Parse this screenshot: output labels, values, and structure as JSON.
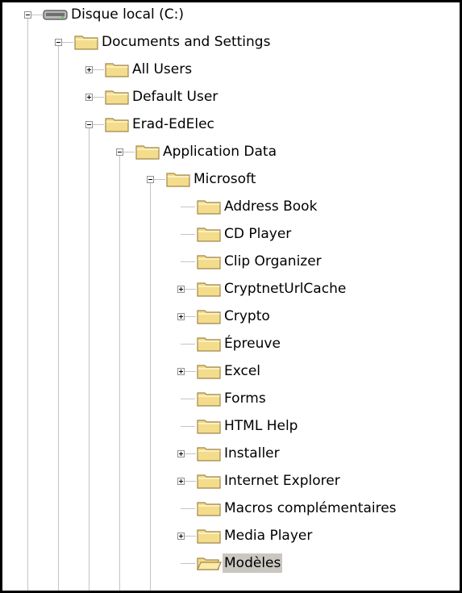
{
  "tree": {
    "nodes": [
      {
        "label": "Disque local (C:)",
        "level": 0,
        "expander": "minus",
        "icon": "drive-icon"
      },
      {
        "label": "Documents and Settings",
        "level": 1,
        "expander": "minus",
        "icon": "folder-icon"
      },
      {
        "label": "All Users",
        "level": 2,
        "expander": "plus",
        "icon": "folder-icon"
      },
      {
        "label": "Default User",
        "level": 2,
        "expander": "plus",
        "icon": "folder-icon"
      },
      {
        "label": "Erad-EdElec",
        "level": 2,
        "expander": "minus",
        "icon": "folder-icon"
      },
      {
        "label": "Application Data",
        "level": 3,
        "expander": "minus",
        "icon": "folder-icon"
      },
      {
        "label": "Microsoft",
        "level": 4,
        "expander": "minus",
        "icon": "folder-icon"
      },
      {
        "label": "Address Book",
        "level": 5,
        "expander": "none",
        "icon": "folder-icon"
      },
      {
        "label": "CD Player",
        "level": 5,
        "expander": "none",
        "icon": "folder-icon"
      },
      {
        "label": "Clip Organizer",
        "level": 5,
        "expander": "none",
        "icon": "folder-icon"
      },
      {
        "label": "CryptnetUrlCache",
        "level": 5,
        "expander": "plus",
        "icon": "folder-icon"
      },
      {
        "label": "Crypto",
        "level": 5,
        "expander": "plus",
        "icon": "folder-icon"
      },
      {
        "label": "Épreuve",
        "level": 5,
        "expander": "none",
        "icon": "folder-icon"
      },
      {
        "label": "Excel",
        "level": 5,
        "expander": "plus",
        "icon": "folder-icon"
      },
      {
        "label": "Forms",
        "level": 5,
        "expander": "none",
        "icon": "folder-icon"
      },
      {
        "label": "HTML Help",
        "level": 5,
        "expander": "none",
        "icon": "folder-icon"
      },
      {
        "label": "Installer",
        "level": 5,
        "expander": "plus",
        "icon": "folder-icon"
      },
      {
        "label": "Internet Explorer",
        "level": 5,
        "expander": "plus",
        "icon": "folder-icon"
      },
      {
        "label": "Macros complémentaires",
        "level": 5,
        "expander": "none",
        "icon": "folder-icon"
      },
      {
        "label": "Media Player",
        "level": 5,
        "expander": "plus",
        "icon": "folder-icon"
      },
      {
        "label": "Modèles",
        "level": 5,
        "expander": "none",
        "icon": "open-folder-icon",
        "selected": true
      }
    ]
  },
  "colors": {
    "folder_fill": "#f3dc8c",
    "folder_stroke": "#a1874a",
    "selection": "#c9c7c0",
    "tree_line": "#8a8a8a"
  }
}
